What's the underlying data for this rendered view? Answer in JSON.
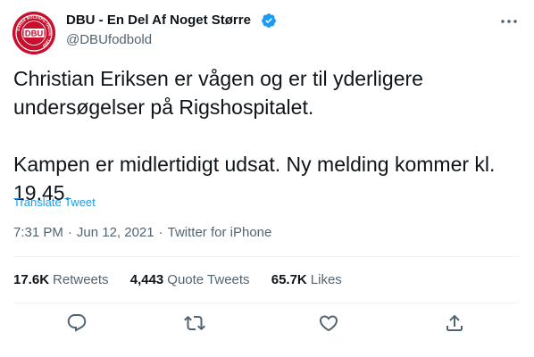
{
  "author": {
    "name": "DBU - En Del Af Noget Større",
    "handle": "@DBUfodbold",
    "avatar_logo_text": "DBU",
    "avatar_ring_text": "DANSK BOLDSPIL-UNION · 1889"
  },
  "tweet": {
    "paragraphs": [
      "Christian Eriksen er vågen og er til yderligere undersøgelser på Rigshospitalet.",
      "Kampen er midlertidigt udsat. Ny melding kommer kl. 19.45."
    ],
    "translate_label": "Translate Tweet"
  },
  "meta": {
    "time": "7:31 PM",
    "date": "Jun 12, 2021",
    "source": "Twitter for iPhone",
    "separator": "·"
  },
  "stats": [
    {
      "value": "17.6K",
      "label": "Retweets"
    },
    {
      "value": "4,443",
      "label": "Quote Tweets"
    },
    {
      "value": "65.7K",
      "label": "Likes"
    }
  ],
  "actions": [
    "reply-icon",
    "retweet-icon",
    "like-icon",
    "share-icon"
  ],
  "colors": {
    "link": "#1d9bf0",
    "muted": "#536471",
    "text": "#0f1419",
    "verified": "#1d9bf0",
    "avatar": "#c8102e"
  }
}
